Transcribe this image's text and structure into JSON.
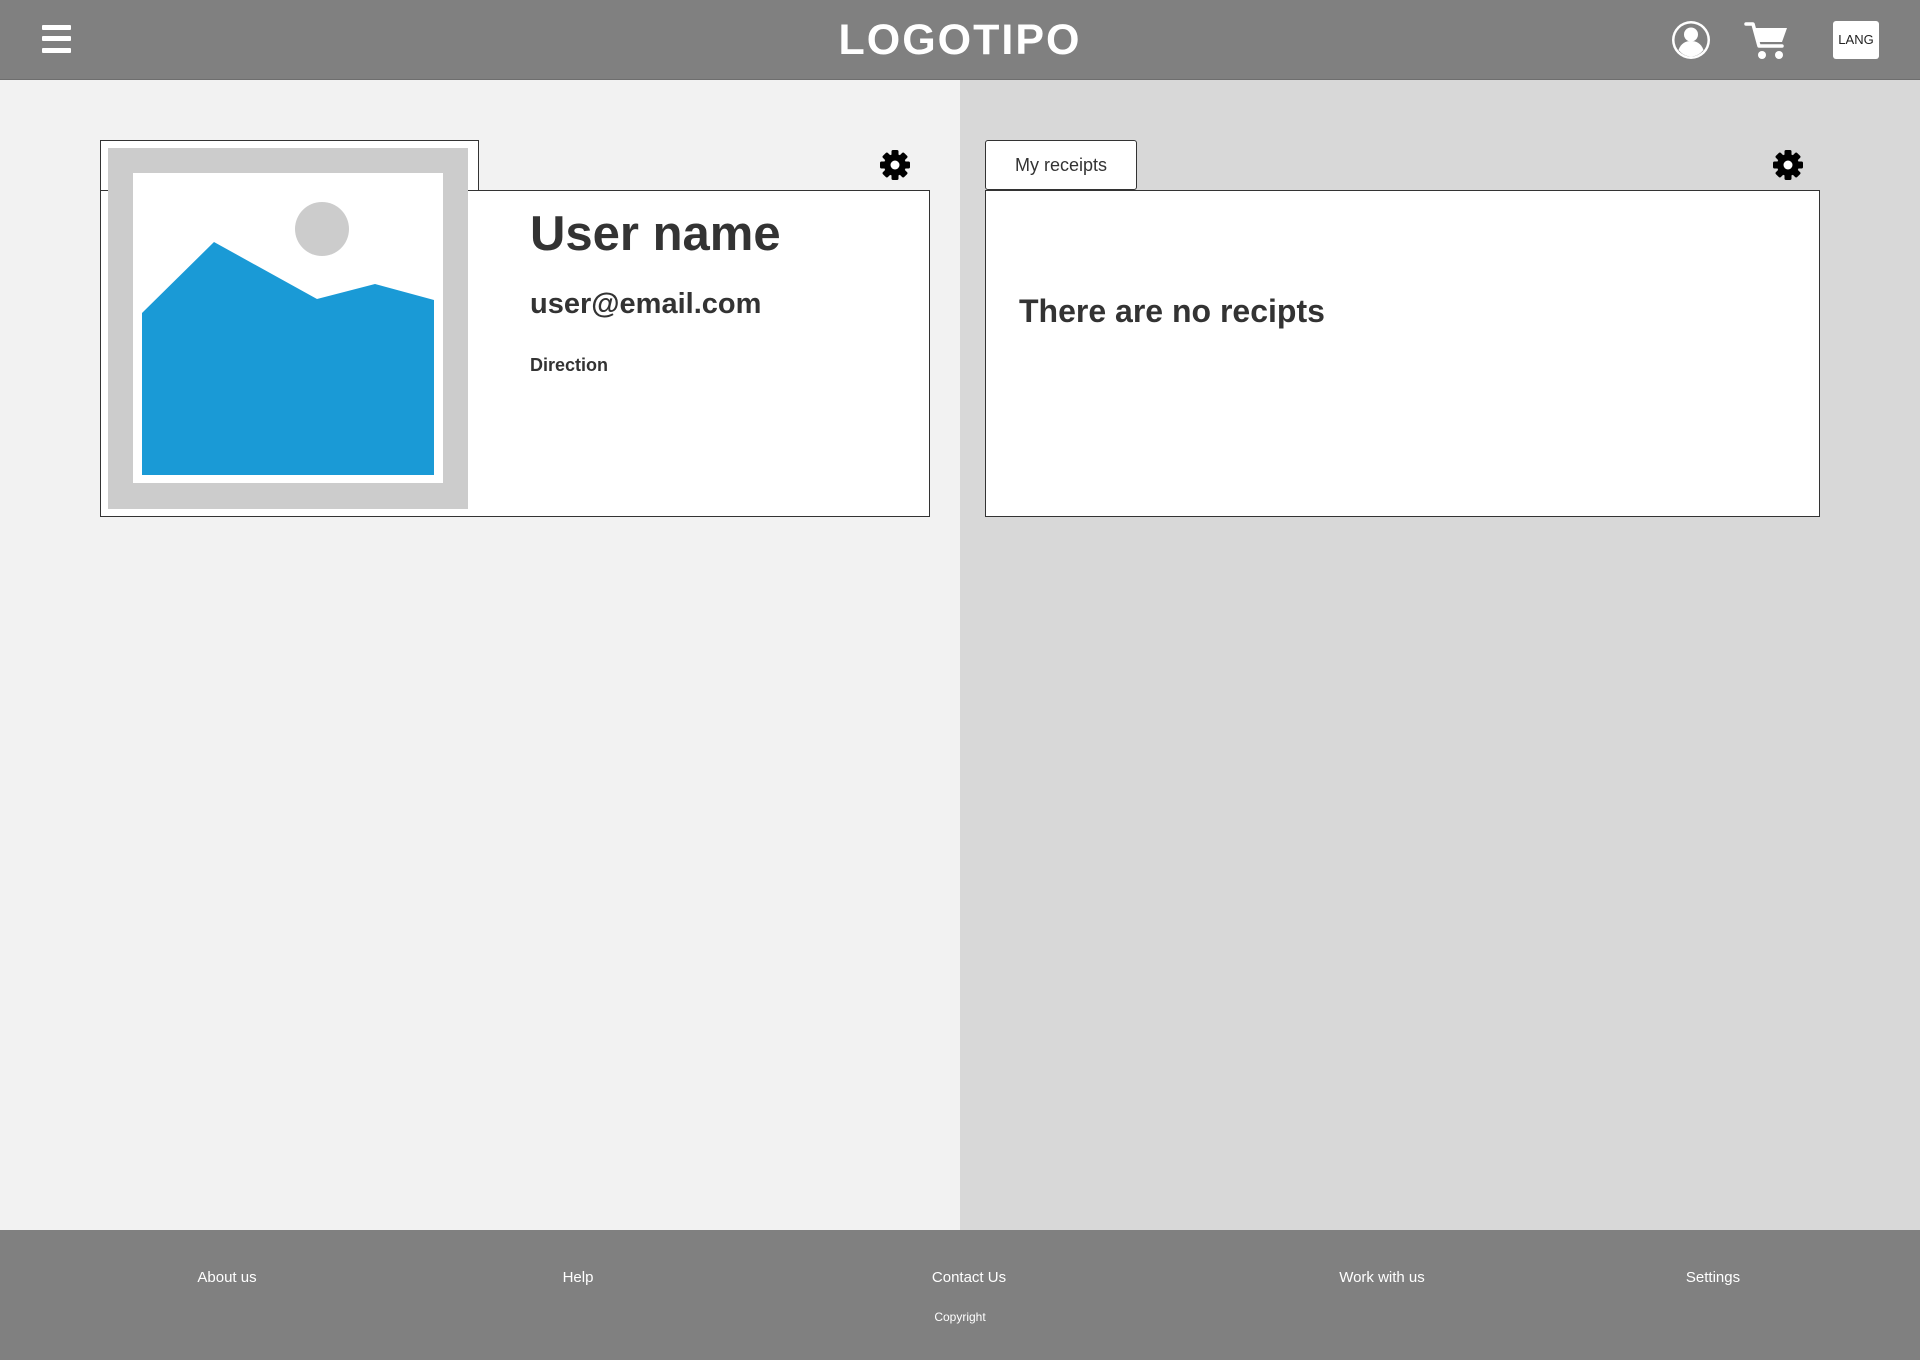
{
  "header": {
    "menu_icon": "hamburger-menu-icon",
    "logo": "LOGOTIPO",
    "user_icon": "user-account-icon",
    "cart_icon": "shopping-cart-icon",
    "lang_label": "LANG"
  },
  "profile": {
    "image_icon": "image-placeholder-icon",
    "settings_icon": "gear-icon",
    "name": "User name",
    "email": "user@email.com",
    "direction": "Direction"
  },
  "receipts": {
    "tab_label": "My receipts",
    "settings_icon": "gear-icon",
    "empty_message": "There are no recipts"
  },
  "footer": {
    "links": [
      "About us",
      "Help",
      "Contact Us",
      "Work with us",
      "Settings"
    ],
    "copyright": "Copyright"
  },
  "colors": {
    "header_bg": "#808080",
    "footer_bg": "#808080",
    "left_bg": "#f2f2f2",
    "right_bg": "#d8d8d8",
    "image_accent": "#1a9ad6",
    "text": "#333333"
  }
}
